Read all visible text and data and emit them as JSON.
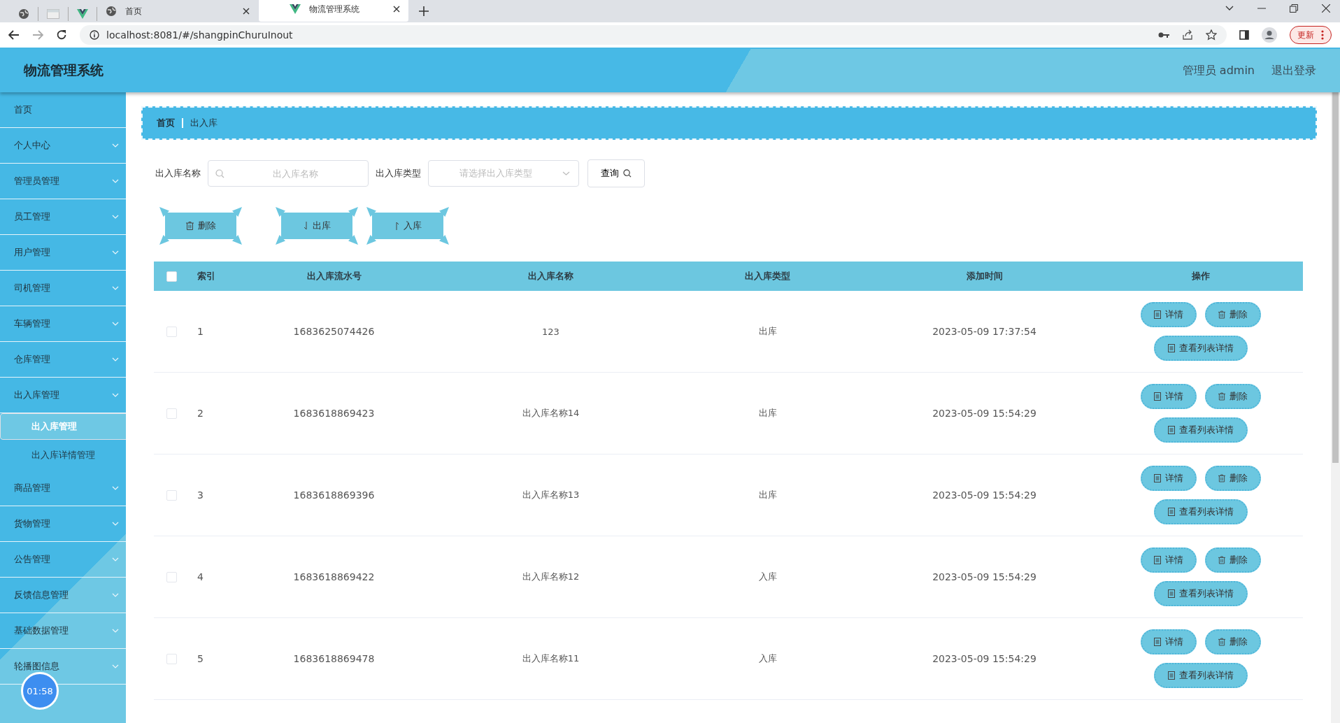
{
  "browser": {
    "tabs": [
      {
        "kind": "pinned",
        "selected": false
      },
      {
        "kind": "pinned",
        "selected": false
      },
      {
        "kind": "pinned",
        "selected": false
      },
      {
        "kind": "page",
        "label": "首页",
        "selected": false
      },
      {
        "kind": "page",
        "label": "物流管理系统",
        "selected": true
      }
    ],
    "address": "localhost:8081/#/shangpinChuruInout",
    "update_button": "更新"
  },
  "header": {
    "title": "物流管理系统",
    "user": "管理员 admin",
    "logout": "退出登录"
  },
  "sidebar": {
    "items": [
      {
        "label": "首页",
        "kind": "link"
      },
      {
        "label": "个人中心",
        "kind": "group"
      },
      {
        "label": "管理员管理",
        "kind": "group"
      },
      {
        "label": "员工管理",
        "kind": "group"
      },
      {
        "label": "用户管理",
        "kind": "group"
      },
      {
        "label": "司机管理",
        "kind": "group"
      },
      {
        "label": "车辆管理",
        "kind": "group"
      },
      {
        "label": "仓库管理",
        "kind": "group"
      },
      {
        "label": "出入库管理",
        "kind": "group",
        "children": [
          {
            "label": "出入库管理",
            "selected": true
          },
          {
            "label": "出入库详情管理",
            "selected": false
          }
        ]
      },
      {
        "label": "商品管理",
        "kind": "group"
      },
      {
        "label": "货物管理",
        "kind": "group"
      },
      {
        "label": "公告管理",
        "kind": "group"
      },
      {
        "label": "反馈信息管理",
        "kind": "group"
      },
      {
        "label": "基础数据管理",
        "kind": "group"
      },
      {
        "label": "轮播图信息",
        "kind": "group"
      }
    ],
    "timer_badge": "01:58"
  },
  "breadcrumb": [
    "首页",
    "出入库"
  ],
  "search": {
    "name_label": "出入库名称",
    "name_placeholder": "出入库名称",
    "type_label": "出入库类型",
    "type_placeholder": "请选择出入库类型",
    "query_button": "查询"
  },
  "actions": [
    {
      "kind": "delete",
      "label": "删除"
    },
    {
      "kind": "out",
      "label": "出库"
    },
    {
      "kind": "in",
      "label": "入库"
    }
  ],
  "table": {
    "select_all_checked": false,
    "columns": [
      "索引",
      "出入库流水号",
      "出入库名称",
      "出入库类型",
      "添加时间",
      "操作"
    ],
    "rows": [
      {
        "checked": false,
        "index": "1",
        "serial": "1683625074426",
        "name": "123",
        "type": "出库",
        "time": "2023-05-09 17:37:54",
        "buttons": [
          "详情",
          "删除",
          "查看列表详情"
        ]
      },
      {
        "checked": false,
        "index": "2",
        "serial": "1683618869423",
        "name": "出入库名称14",
        "type": "出库",
        "time": "2023-05-09 15:54:29",
        "buttons": [
          "详情",
          "删除",
          "查看列表详情"
        ]
      },
      {
        "checked": false,
        "index": "3",
        "serial": "1683618869396",
        "name": "出入库名称13",
        "type": "出库",
        "time": "2023-05-09 15:54:29",
        "buttons": [
          "详情",
          "删除",
          "查看列表详情"
        ]
      },
      {
        "checked": false,
        "index": "4",
        "serial": "1683618869422",
        "name": "出入库名称12",
        "type": "入库",
        "time": "2023-05-09 15:54:29",
        "buttons": [
          "详情",
          "删除",
          "查看列表详情"
        ]
      },
      {
        "checked": false,
        "index": "5",
        "serial": "1683618869478",
        "name": "出入库名称11",
        "type": "入库",
        "time": "2023-05-09 15:54:29",
        "buttons": [
          "详情",
          "删除",
          "查看列表详情"
        ]
      }
    ]
  }
}
